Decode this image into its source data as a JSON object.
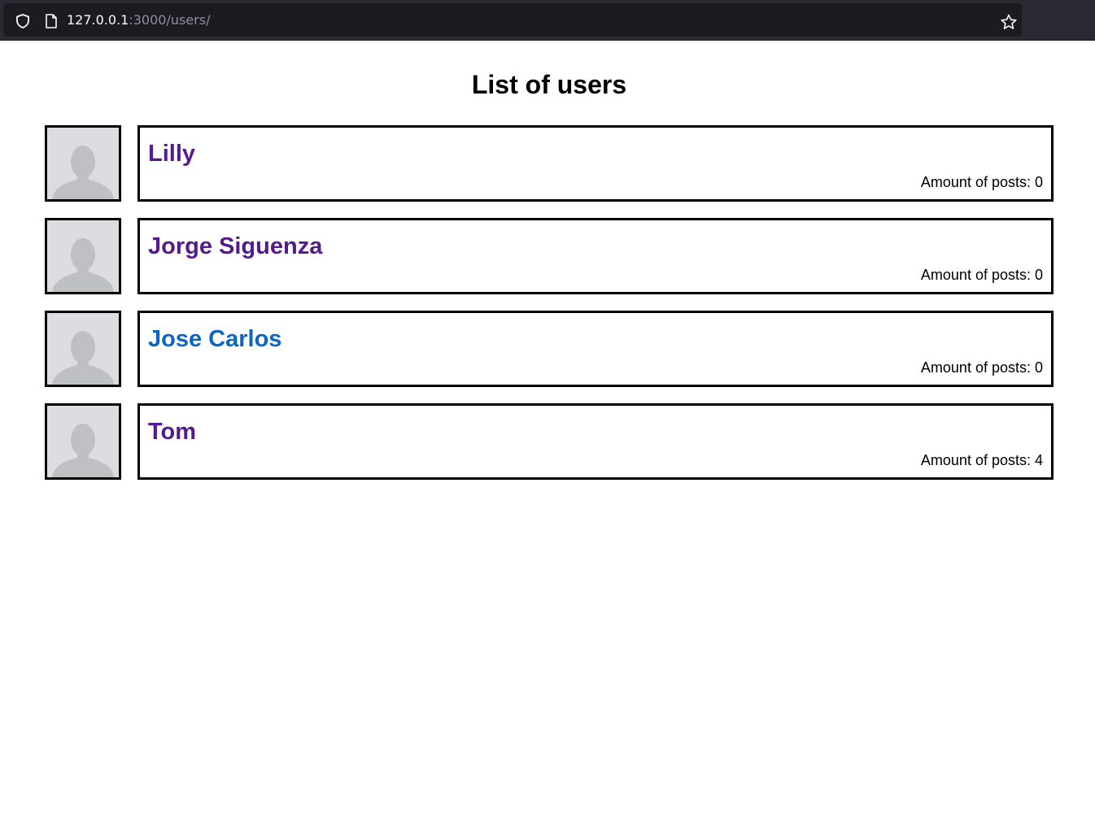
{
  "browser": {
    "url_host": "127.0.0.1",
    "url_path": ":3000/users/"
  },
  "page": {
    "title": "List of users"
  },
  "users": [
    {
      "name": "Lilly",
      "posts_label": "Amount of posts: 0",
      "link_state": "visited"
    },
    {
      "name": "Jorge Siguenza",
      "posts_label": "Amount of posts: 0",
      "link_state": "visited"
    },
    {
      "name": "Jose Carlos",
      "posts_label": "Amount of posts: 0",
      "link_state": "unvisited"
    },
    {
      "name": "Tom",
      "posts_label": "Amount of posts: 4",
      "link_state": "visited"
    }
  ],
  "colors": {
    "visited_link": "#551a8b",
    "unvisited_link": "#0a66c2",
    "avatar_bg": "#dcdde0",
    "avatar_silhouette": "#bfc0c4",
    "browser_bg": "#2b2a33",
    "urlbar_bg": "#1c1b22"
  },
  "icons": {
    "shield": "shield-icon",
    "page": "page-icon",
    "star": "bookmark-star-icon",
    "avatar": "default-avatar-icon"
  }
}
